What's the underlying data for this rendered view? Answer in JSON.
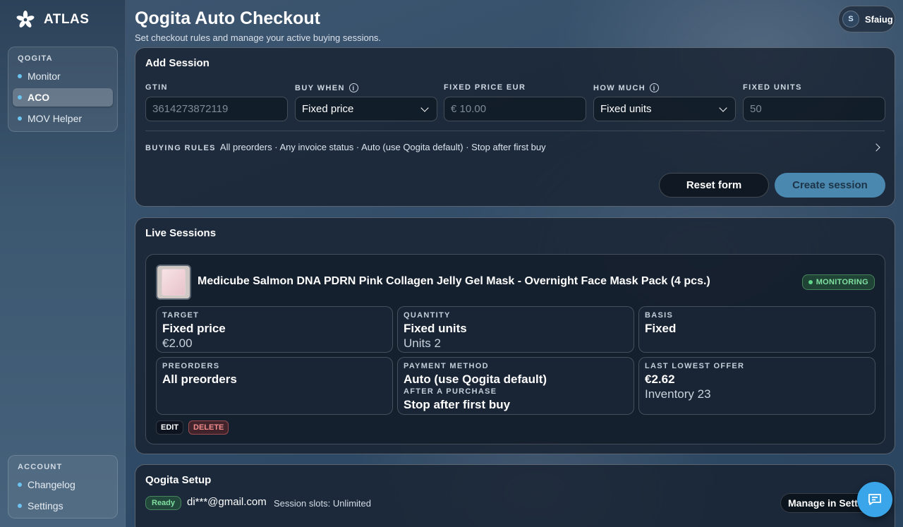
{
  "brand": {
    "name": "ATLAS"
  },
  "sidebar": {
    "groups": [
      {
        "title": "QOGITA",
        "items": [
          {
            "label": "Monitor"
          },
          {
            "label": "ACO"
          },
          {
            "label": "MOV Helper"
          }
        ]
      },
      {
        "title": "ACCOUNT",
        "items": [
          {
            "label": "Changelog"
          },
          {
            "label": "Settings"
          }
        ]
      }
    ],
    "active_item": "ACO"
  },
  "header": {
    "title": "Qogita Auto Checkout",
    "subtitle": "Set checkout rules and manage your active buying sessions."
  },
  "user": {
    "initial": "S",
    "name": "Sfaiug"
  },
  "add_session": {
    "title": "Add Session",
    "fields": [
      {
        "label": "GTIN",
        "placeholder": "3614273872119"
      },
      {
        "label": "BUY WHEN",
        "value": "Fixed price"
      },
      {
        "label": "FIXED PRICE EUR",
        "placeholder": "€ 10.00"
      },
      {
        "label": "HOW MUCH",
        "value": "Fixed units"
      },
      {
        "label": "FIXED UNITS",
        "placeholder": "50"
      }
    ],
    "rules_label": "BUYING RULES",
    "rules_summary": "All preorders · Any invoice status · Auto (use Qogita default) · Stop after first buy",
    "reset_label": "Reset form",
    "create_label": "Create session"
  },
  "live_sessions": {
    "title": "Live Sessions",
    "session": {
      "product": "Medicube Salmon DNA PDRN Pink Collagen Jelly Gel Mask - Overnight Face Mask Pack (4 pcs.)",
      "status": "MONITORING",
      "target": {
        "label": "TARGET",
        "value": "Fixed price",
        "sub": "€2.00"
      },
      "quantity": {
        "label": "QUANTITY",
        "value": "Fixed units",
        "sub": "Units 2"
      },
      "basis": {
        "label": "BASIS",
        "value": "Fixed"
      },
      "preorders": {
        "label": "PREORDERS",
        "value": "All preorders"
      },
      "payment": {
        "label": "PAYMENT METHOD",
        "value": "Auto (use Qogita default)",
        "after_label": "AFTER A PURCHASE",
        "after_value": "Stop after first buy"
      },
      "last_offer": {
        "label": "LAST LOWEST OFFER",
        "value": "€2.62",
        "sub": "Inventory 23"
      },
      "edit_label": "EDIT",
      "delete_label": "DELETE"
    }
  },
  "setup": {
    "title": "Qogita Setup",
    "status": "Ready",
    "email": "di***@gmail.com",
    "slots": "Session slots: Unlimited",
    "manage_label": "Manage in Settings"
  },
  "colors": {
    "accent": "#3aa5e8",
    "create_button": "#4a88b0",
    "success": "#5fd488",
    "danger": "#f08b8b"
  }
}
